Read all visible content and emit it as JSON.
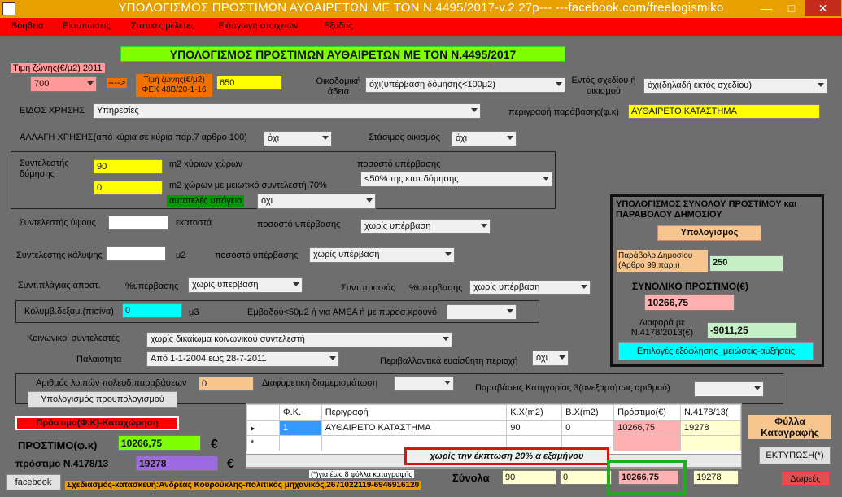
{
  "window": {
    "title": "ΥΠΟΛΟΓΙΣΜΟΣ ΠΡΟΣΤΙΜΩΝ ΑΥΘΑΙΡΕΤΩΝ ΜΕ ΤΟΝ Ν.4495/2017-v.2.27p---          ---facebook.com/freelogismiko",
    "min": "—",
    "max": "□",
    "close": "✕"
  },
  "menu": [
    "Βοηθεια",
    "Εκτυπωσεις",
    "Στατικες μελετες",
    "Εισαγωγη στοιχειων",
    "Εξοδος"
  ],
  "heading": "ΥΠΟΛΟΓΙΣΜΟΣ ΠΡΟΣΤΙΜΩΝ  ΑΥΘΑΙΡΕΤΩΝ ΜΕ ΤΟΝ Ν.4495/2017",
  "zone": {
    "label": "Τιμή ζώνης(€/μ2) 2011",
    "value": "700",
    "arrow": "---->",
    "fek_label": "Τιμή ζώνης(€/μ2) ΦΕΚ 48Β/20-1-16",
    "fek_value": "650"
  },
  "permit": {
    "label": "Οικοδομική άδεια",
    "value": "όχι(υπέρβαση δόμησης<100μ2)"
  },
  "plan": {
    "label": "Εντός σχεδίου ή οικισμού",
    "value": "όχι(δηλαδή εκτός σχεδίου)"
  },
  "use": {
    "label": "ΕΙΔΟΣ ΧΡΗΣΗΣ",
    "value": "Υπηρεσίες"
  },
  "descr": {
    "label": "περιγραφή παράβασης(φ.κ)",
    "value": "ΑΥΘΑΙΡΕΤΟ ΚΑΤΑΣΤΗΜΑ"
  },
  "change": {
    "label": "ΑΛΛΑΓΗ ΧΡΗΣΗΣ(από κύρια σε κύρια παρ.7 αρθρο 100)",
    "value": "όχι"
  },
  "parking": {
    "label": "Στάσιμος οικισμός",
    "value": "όχι"
  },
  "building": {
    "label": "Συντελεστής δόμησης",
    "main_value": "90",
    "main_label": "m2 κύριων χώρων",
    "red_value": "0",
    "red_label": "m2  χώρων με μειωτικό συντελεστή 70%",
    "pct_label": "ποσοστό υπέρβασης",
    "pct_value": "<50% της επιτ.δόμησης",
    "indep_label": "αυτοτελές υπόγειο",
    "indep_value": "όχι"
  },
  "height": {
    "label": "Συντελεστής ύψους",
    "value": "",
    "unit": "εκατοστά",
    "pct_label": "ποσοστό υπέρβασης",
    "pct_value": "χωρίς υπέρβαση"
  },
  "coverage": {
    "label": "Συντελεστής κάλυψης",
    "value": "",
    "unit": "μ2",
    "pct_label": "ποσοστό υπέρβασης",
    "pct_value": "χωρίς υπέρβαση"
  },
  "side": {
    "label": "Συντ.πλάγιας αποστ.",
    "pct_label": "%υπερβασης",
    "value": "χωρις υπερβαση",
    "front_label": "Συντ.πρασιάς",
    "front_pct_label": "%υπερβασης",
    "front_value": "χωρίς υπέρβαση"
  },
  "pool": {
    "label": "Κολυμβ.δεξαμ.(πισίνα)",
    "value": "0",
    "unit": "μ3",
    "amea_label": "Εμβαδού<50μ2 ή για ΑΜΕΑ ή με πυροσ.κρουνό",
    "amea_value": ""
  },
  "social": {
    "label": "Κοινωνικοί συντελεστές",
    "value": "χωρίς δικαίωμα κοινωνικού συντελεστή"
  },
  "age": {
    "label": "Παλαιοτητα",
    "value": "Από 1-1-2004 εως 28-7-2011",
    "env_label": "Περιβαλλοντικά ευαίσθητη περιοχή",
    "env_value": "όχι"
  },
  "other": {
    "label": "Αριθμός λοιπών πολεοδ.παραβάσεων",
    "value": "0",
    "diff_label": "Διαφορετική διαμερισμάτωση",
    "diff_value": "",
    "cat3_label": "Παραβάσεις Κατηγορίας 3(ανεξαρτήτως αριθμού)",
    "cat3_value": "",
    "budget_btn": "Υπολογισμός προυπολογισμού"
  },
  "totals_panel": {
    "title": "ΥΠΟΛΟΓΙΣΜΟΣ ΣΥΝΟΛΟΥ ΠΡΟΣΤΙΜΟΥ και ΠΑΡΑΒΟΛΟΥ ΔΗΜΟΣΙΟΥ",
    "calc_btn": "Υπολογισμός",
    "fee_label": "Παράβολο Δημοσίου (Αρθρο 99,παρ.ι)",
    "fee_value": "250",
    "total_label": "ΣΥΝΟΛΙΚΟ ΠΡΟΣΤΙΜΟ(€)",
    "total_value": "10266,75",
    "diff_label": "Διαφορά με Ν.4178/2013(€)",
    "diff_value": "-9011,25",
    "options_btn": "Επιλογές εξόφλησης_μειώσεις-αυξήσεις"
  },
  "left_bottom": {
    "register": "Πρόστιμο(Φ.Κ)-Καταχώρηση",
    "fine_label": "ΠΡΟΣΤΙΜΟ(φ.κ)",
    "fine_value": "10266,75",
    "euro": "€",
    "old_label": "πρόστιμο Ν.4178/13",
    "old_value": "19278",
    "euro2": "€"
  },
  "grid": {
    "headers": [
      "Φ.Κ.",
      "Περιγραφή",
      "Κ.Χ(m2)",
      "Β.Χ(m2)",
      "Πρόστιμο(€)",
      "Ν.4178/13("
    ],
    "rows": [
      [
        "1",
        "ΑΥΘΑΙΡΕΤΟ ΚΑΤΑΣΤΗΜΑ",
        "90",
        "0",
        "10266,75",
        "19278"
      ]
    ]
  },
  "discount": "χωρίς την έκπτωση 20% α εξαμήνου",
  "footnote": "(*)για έως 8 φύλλα καταγραφής",
  "sums": {
    "label": "Σύνολα",
    "kx": "90",
    "bx": "0",
    "fine": "10266,75",
    "old": "19278"
  },
  "sheets": "Φύλλα Καταγραφής",
  "print_btn": "ΕΚΤΥΠΩΣΗ(*)",
  "gifts_btn": "Δωρεές",
  "facebook_btn": "facebook",
  "credit": "Σχεδιασμός-κατασκευή:Ανδρέας Κουρούκλης-πολιτικός μηχανικός,2671022119-6946916120",
  "colors": {
    "title": "#e8a000",
    "menu": "#ff0000",
    "field": "#ffff00"
  }
}
